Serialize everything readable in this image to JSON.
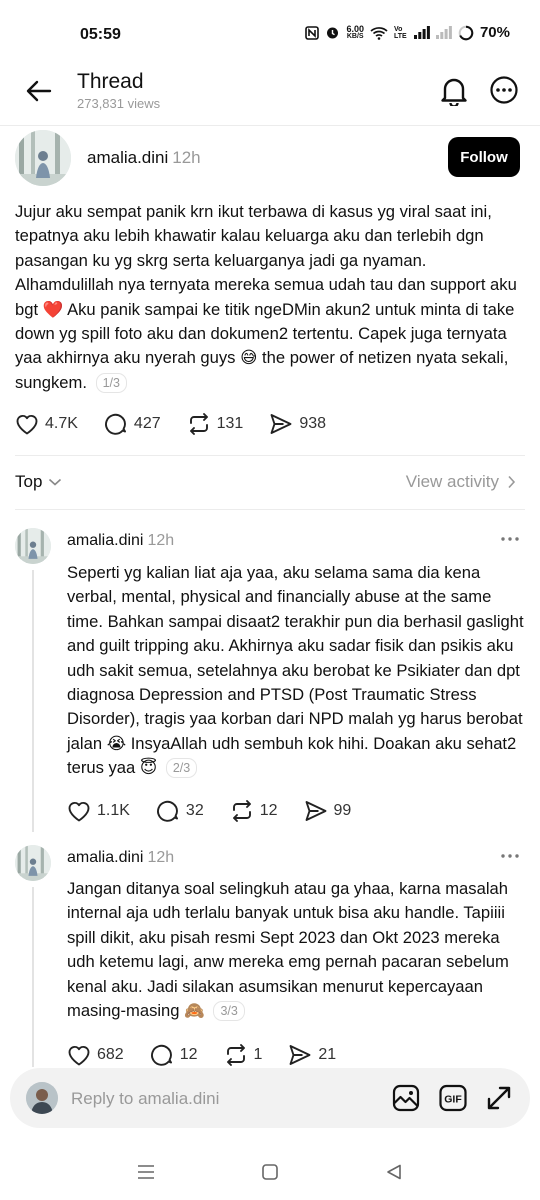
{
  "status_bar": {
    "time": "05:59",
    "speed_value": "6.00",
    "speed_unit": "KB/S",
    "volte": "Vo LTE",
    "battery": "70%"
  },
  "header": {
    "title": "Thread",
    "views": "273,831 views"
  },
  "main_post": {
    "username": "amalia.dini",
    "time": "12h",
    "follow_label": "Follow",
    "text_part1": "Jujur aku sempat panik krn ikut terbawa di kasus yg viral saat ini, tepatnya aku lebih khawatir kalau keluarga aku dan terlebih dgn pasangan ku yg skrg serta keluarganya jadi ga nyaman. Alhamdulillah nya ternyata mereka semua udah tau dan support aku bgt",
    "emoji1": "❤️",
    "text_part2": " Aku panik sampai ke titik ngeDMin akun2 untuk minta di take down yg spill foto aku dan dokumen2 tertentu. Capek juga ternyata yaa akhirnya aku nyerah guys",
    "emoji2": "😅",
    "text_part3": " the power of netizen nyata sekali, sungkem.",
    "page": "1/3",
    "likes": "4.7K",
    "comments": "427",
    "reposts": "131",
    "shares": "938"
  },
  "sort": {
    "label": "Top",
    "view_activity": "View activity"
  },
  "replies": [
    {
      "username": "amalia.dini",
      "time": "12h",
      "text": "Seperti yg kalian liat aja yaa, aku selama sama dia kena verbal, mental, physical and financially abuse at the same time. Bahkan sampai disaat2 terakhir pun dia berhasil gaslight and guilt tripping aku. Akhirnya aku sadar fisik dan psikis aku udh sakit semua, setelahnya aku berobat ke Psikiater dan dpt diagnosa Depression and PTSD (Post Traumatic Stress Disorder), tragis yaa korban dari NPD malah yg harus berobat jalan",
      "emoji1": "😭",
      "text2": " InsyaAllah udh sembuh kok hihi. Doakan aku sehat2 terus yaa",
      "emoji2": "😇",
      "page": "2/3",
      "likes": "1.1K",
      "comments": "32",
      "reposts": "12",
      "shares": "99"
    },
    {
      "username": "amalia.dini",
      "time": "12h",
      "text": "Jangan ditanya soal selingkuh atau ga yhaa, karna masalah internal aja udh terlalu banyak untuk bisa aku handle. Tapiiii spill dikit, aku pisah resmi Sept 2023 dan Okt 2023 mereka udh ketemu lagi, anw mereka emg pernah pacaran sebelum kenal aku. Jadi silakan asumsikan menurut kepercayaan masing-masing",
      "emoji1": "🙈",
      "page": "3/3",
      "likes": "682",
      "comments": "12",
      "reposts": "1",
      "shares": "21"
    }
  ],
  "reply_bar": {
    "placeholder": "Reply to amalia.dini"
  },
  "icons": {
    "back": "back-arrow-icon",
    "bell": "bell-icon",
    "more": "more-icon",
    "like": "heart-icon",
    "comment": "comment-icon",
    "repost": "repost-icon",
    "share": "share-icon",
    "image": "image-icon",
    "gif": "gif-icon",
    "expand": "expand-icon"
  }
}
